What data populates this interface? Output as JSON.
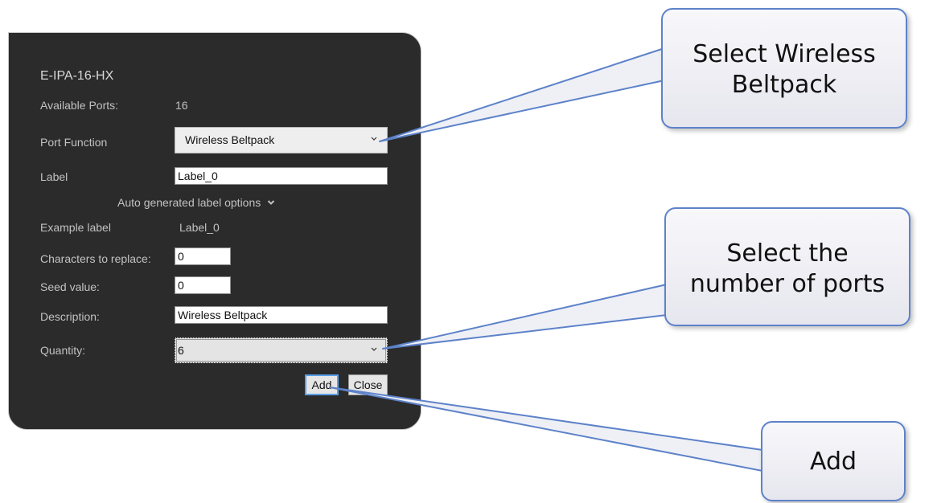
{
  "dialog": {
    "title": "E-IPA-16-HX",
    "available_ports_label": "Available Ports:",
    "available_ports_value": "16",
    "port_function_label": "Port Function",
    "port_function_value": "Wireless Beltpack",
    "label_label": "Label",
    "label_value": "Label_0",
    "auto_generated_label": "Auto generated label options",
    "example_label_label": "Example label",
    "example_label_value": "Label_0",
    "chars_to_replace_label": "Characters to replace:",
    "chars_to_replace_value": "0",
    "seed_value_label": "Seed value:",
    "seed_value_value": "0",
    "description_label": "Description:",
    "description_value": "Wireless Beltpack",
    "quantity_label": "Quantity:",
    "quantity_value": "6",
    "add_button": "Add",
    "close_button": "Close"
  },
  "callouts": {
    "select_beltpack": [
      "Select Wireless",
      "Beltpack"
    ],
    "select_ports": [
      "Select the",
      "number of ports"
    ],
    "add": "Add"
  },
  "colors": {
    "dialog_bg": "#2b2b2b",
    "callout_border": "#5d82c9",
    "focus_blue": "#5aa0e8"
  }
}
